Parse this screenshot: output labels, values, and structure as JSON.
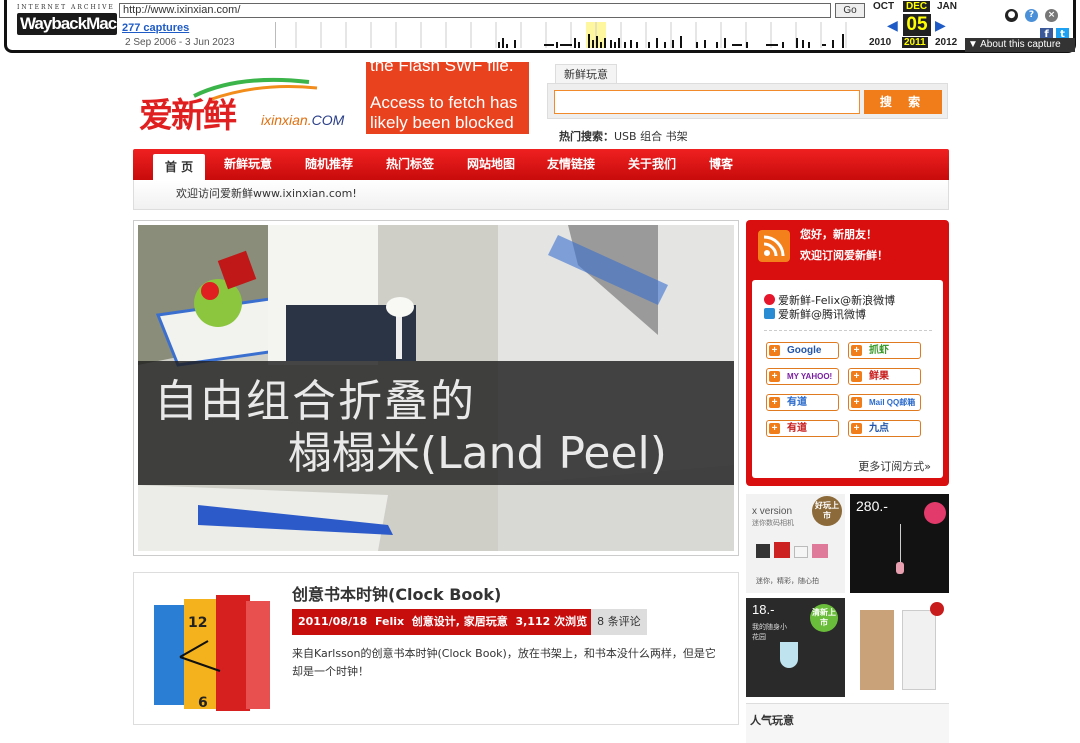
{
  "wayback": {
    "ia_label": "INTERNET ARCHIVE",
    "logo_text": "WaybackMachine",
    "url": "http://www.ixinxian.com/",
    "go": "Go",
    "captures": "277 captures",
    "range": "2 Sep 2006 - 3 Jun 2023",
    "months": [
      "OCT",
      "DEC",
      "JAN"
    ],
    "day": "05",
    "years": [
      "2010",
      "2011",
      "2012"
    ],
    "about": "▼ About this capture"
  },
  "site": {
    "logo_cn": "爱新鲜",
    "logo_en_a": "ixinxian.",
    "logo_en_b": "COM",
    "flash_line1": "the Flash SWF file.",
    "flash_line2": "Access to fetch has likely been blocked",
    "search_tab": "新鲜玩意",
    "search_placeholder": "",
    "search_button": "搜 索",
    "hot_label": "热门搜索：",
    "hot_terms": "USB 组合 书架"
  },
  "nav": {
    "items": [
      "首 页",
      "新鲜玩意",
      "随机推荐",
      "热门标签",
      "网站地图",
      "友情链接",
      "关于我们",
      "博客"
    ]
  },
  "welcome": "欢迎访问爱新鲜www.ixinxian.com!",
  "hero": {
    "line1": "自由组合折叠的",
    "line2": "榻榻米(Land Peel)"
  },
  "article": {
    "title": "创意书本时钟(Clock Book)",
    "date": "2011/08/18",
    "author": "Felix",
    "tags": "创意设计, 家居玩意",
    "views": "3,112 次浏览",
    "comments": "8 条评论",
    "body": "来自Karlsson的创意书本时钟(Clock Book)，放在书架上，和书本没什么两样，但是它却是一个时钟！"
  },
  "rss": {
    "hello": "您好，新朋友！",
    "subscribe": "欢迎订阅爱新鲜！",
    "weibo1": "爱新鲜-Felix@新浪微博",
    "weibo2": "爱新鲜@腾讯微博",
    "buttons": [
      "Google",
      "抓虾",
      "MY YAHOO!",
      "鲜果",
      "有道",
      "Mail QQ邮箱",
      "有道",
      "九点"
    ],
    "more": "更多订阅方式»"
  },
  "ads": {
    "ad1_title": "x version",
    "ad1_sub": "迷你数码相机",
    "ad1_badge": "好玩上市",
    "ad1_caption": "迷你，精彩，随心拍",
    "ad2_price": "280.-",
    "ad3_price": "18.-",
    "ad3_badge": "清新上市",
    "ad3_caption": "我的随身小花园"
  },
  "popular": "人气玩意",
  "colors": {
    "nav_red": "#d90f0f",
    "orange": "#f07c1a"
  }
}
